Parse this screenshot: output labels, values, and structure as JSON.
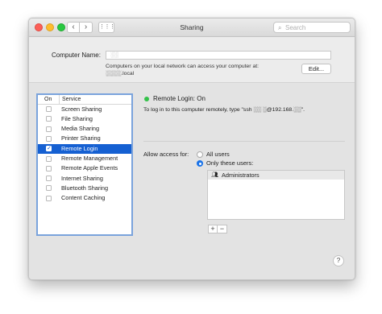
{
  "window": {
    "title": "Sharing"
  },
  "toolbar": {
    "back": "‹",
    "forward": "›",
    "grid": "⋮⋮⋮",
    "search_placeholder": "Search"
  },
  "computer_name": {
    "label": "Computer Name:",
    "value": "░░",
    "info_line1": "Computers on your local network can access your computer at:",
    "info_line2": "░░░░.local",
    "edit_label": "Edit..."
  },
  "services": {
    "col_on": "On",
    "col_service": "Service",
    "items": [
      {
        "label": "Screen Sharing",
        "checked": false
      },
      {
        "label": "File Sharing",
        "checked": false
      },
      {
        "label": "Media Sharing",
        "checked": false
      },
      {
        "label": "Printer Sharing",
        "checked": false
      },
      {
        "label": "Remote Login",
        "checked": true,
        "selected": true
      },
      {
        "label": "Remote Management",
        "checked": false
      },
      {
        "label": "Remote Apple Events",
        "checked": false
      },
      {
        "label": "Internet Sharing",
        "checked": false
      },
      {
        "label": "Bluetooth Sharing",
        "checked": false
      },
      {
        "label": "Content Caching",
        "checked": false
      }
    ]
  },
  "detail": {
    "status": "Remote Login: On",
    "status_color": "#34c24a",
    "instructions": "To log in to this computer remotely, type \"ssh ░░ ░@192.168.░░\".",
    "allow_label": "Allow access for:",
    "option_all": "All users",
    "option_only": "Only these users:",
    "users": [
      "Administrators"
    ],
    "add": "+",
    "remove": "−",
    "help": "?"
  }
}
